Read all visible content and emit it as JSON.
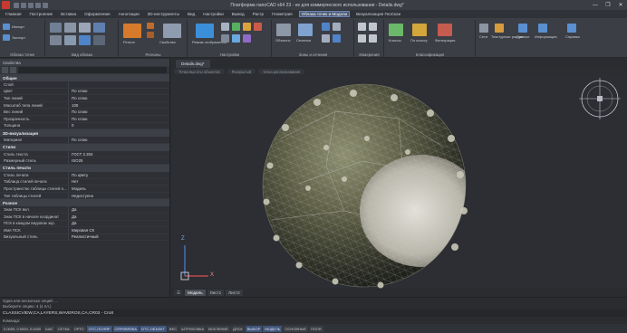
{
  "window": {
    "title": "Платформа nanoCAD x64 23 - не для коммерческого использования - Details.dwg*",
    "controls": [
      "—",
      "❐",
      "✕"
    ]
  },
  "menu": {
    "items": [
      "Главная",
      "Построение",
      "Вставка",
      "Оформление",
      "Аннотации",
      "3D-инструменты",
      "Вид",
      "Настройки",
      "Вывод",
      "Растр",
      "Геометрия",
      "Облака точек и Модели",
      "Визуализация ГеоСкан"
    ],
    "active_index": 11
  },
  "ribbon": {
    "groups": [
      {
        "label": "Облако точек",
        "buttons": [
          "Импорт",
          "Экспорт"
        ]
      },
      {
        "label": "Вид облака",
        "buttons": []
      },
      {
        "label": "Регионы",
        "buttons": [
          "Регион",
          "Свойства"
        ]
      },
      {
        "label": "Настройки",
        "buttons": [
          "Режим отображения"
        ]
      },
      {
        "label": "Зоны и сечения",
        "buttons": [
          "Объекты",
          "Сечения"
        ]
      },
      {
        "label": "Измерения",
        "buttons": []
      },
      {
        "label": "Классификация",
        "buttons": [
          "Классы",
          "По классу",
          "Фильтрация"
        ]
      },
      {
        "label": "",
        "buttons": [
          "Сети",
          "Текстурные растры",
          "Данные",
          "Информация",
          "Справка"
        ]
      }
    ]
  },
  "properties": {
    "header": "Свойства",
    "rows": [
      {
        "type": "section",
        "label": "Общие"
      },
      {
        "type": "row",
        "key": "Слой",
        "value": ""
      },
      {
        "type": "row",
        "key": "Цвет",
        "value": "По слою"
      },
      {
        "type": "row",
        "key": "Тип линий",
        "value": "По слою"
      },
      {
        "type": "row",
        "key": "Масштаб типа линий",
        "value": "100"
      },
      {
        "type": "row",
        "key": "Вес линий",
        "value": "По слою"
      },
      {
        "type": "row",
        "key": "Прозрачность",
        "value": "По слою"
      },
      {
        "type": "row",
        "key": "Толщина",
        "value": "0"
      },
      {
        "type": "section",
        "label": "3D-визуализация"
      },
      {
        "type": "row",
        "key": "Материал",
        "value": "По слою"
      },
      {
        "type": "section",
        "label": "Стили"
      },
      {
        "type": "row",
        "key": "Стиль текста",
        "value": "ГОСТ 2.304"
      },
      {
        "type": "row",
        "key": "Размерный стиль",
        "value": "ISO25"
      },
      {
        "type": "section",
        "label": "Стиль печати"
      },
      {
        "type": "row",
        "key": "Стиль печати",
        "value": "По цвету"
      },
      {
        "type": "row",
        "key": "Таблица стилей печати",
        "value": "Нет"
      },
      {
        "type": "row",
        "key": "Пространство таблицы стилей п...",
        "value": "Модель"
      },
      {
        "type": "row",
        "key": "Тип таблицы стилей",
        "value": "Недоступно"
      },
      {
        "type": "section",
        "label": "Разное"
      },
      {
        "type": "row",
        "key": "Знак ПСК вкл.",
        "value": "Да"
      },
      {
        "type": "row",
        "key": "Знак ПСК в начале координат",
        "value": "Да"
      },
      {
        "type": "row",
        "key": "ПСК в каждом видовом экр.",
        "value": "Да"
      },
      {
        "type": "row",
        "key": "Имя ПСК",
        "value": "Мировая СК"
      },
      {
        "type": "row",
        "key": "Визуальный стиль",
        "value": "Реалистичный"
      }
    ]
  },
  "document": {
    "tab": "Details.dwg*",
    "subtabs": [
      "Точка высоты объектов",
      "Раскрытый",
      "точка распознавания"
    ]
  },
  "layout_tabs": [
    "Модель",
    "Лист1",
    "Лист2"
  ],
  "viewcube": {
    "label": ""
  },
  "axis": {
    "x": "X",
    "y": "Y",
    "z": "Z"
  },
  "command": {
    "history": [
      "Одна или несколько опций: ...",
      "Выберите опцию: 4 (4 пл.)"
    ],
    "current": "CLASSICVIEW,CA,LAYERS,WAVEROS,CA,CR03 - Cro8",
    "prompt": "Команда:"
  },
  "status": {
    "coords": "0.0000, 0.0000, 0.0000",
    "buttons": [
      "ШАГ",
      "СЕТКА",
      "ОРТО",
      "ОТС-ПОЛЯР",
      "ОПРИВЯЗКА",
      "ОТС-ОБЪЕКТ",
      "ВЕС",
      "ШТРИХОВКА",
      "ВСЕЛЕНИЕ",
      "ДПСК",
      "ВЫБОР",
      "МОДЕЛЬ",
      "ОСНОВНЫЕ",
      "ПОЛЯ"
    ]
  },
  "colors": {
    "accent": "#4a5a78",
    "viewport_bg": "#2c2e33",
    "panel_bg": "#2e3035"
  }
}
